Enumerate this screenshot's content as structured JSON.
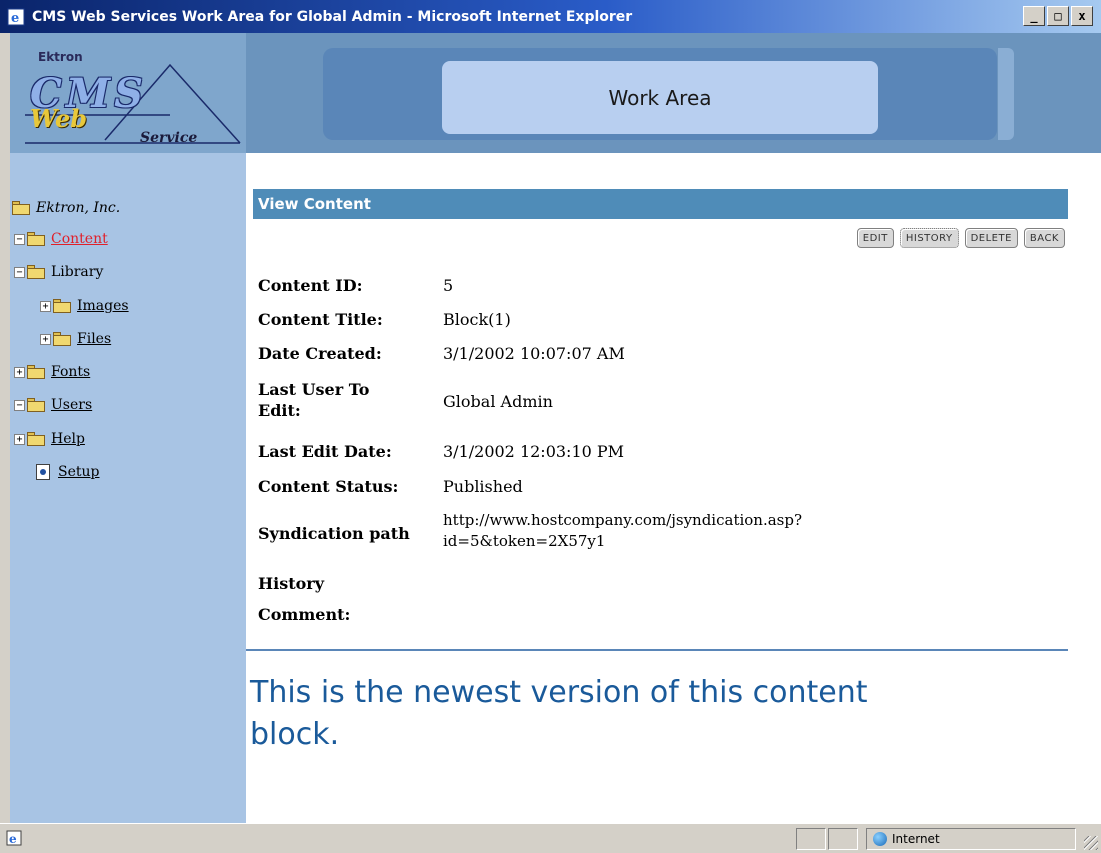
{
  "window": {
    "title": "CMS Web Services Work Area for Global Admin - Microsoft Internet Explorer",
    "minimize": "_",
    "maximize": "□",
    "close": "x"
  },
  "logo": {
    "company": "Ektron",
    "cms": "CMS",
    "web": "Web",
    "service": "Service"
  },
  "header": {
    "title": "Work Area"
  },
  "sidebar": {
    "root": "Ektron, Inc.",
    "items": [
      {
        "label": "Content",
        "icon": "folder-open-icon",
        "active": true
      },
      {
        "label": "Library",
        "icon": "folder-open-icon"
      },
      {
        "label": "Images",
        "icon": "folder-icon"
      },
      {
        "label": "Files",
        "icon": "folder-icon"
      },
      {
        "label": "Fonts",
        "icon": "folder-icon"
      },
      {
        "label": "Users",
        "icon": "folder-open-icon"
      },
      {
        "label": "Help",
        "icon": "folder-icon"
      },
      {
        "label": "Setup",
        "icon": "page-icon"
      }
    ]
  },
  "main": {
    "section_title": "View Content",
    "actions": {
      "edit": "EDIT",
      "history": "HISTORY",
      "delete": "DELETE",
      "back": "BACK"
    },
    "details": {
      "content_id_label": "Content ID:",
      "content_id": "5",
      "content_title_label": "Content Title:",
      "content_title": "Block(1)",
      "date_created_label": "Date Created:",
      "date_created": "3/1/2002 10:07:07 AM",
      "last_user_label_1": "Last User To",
      "last_user_label_2": "Edit:",
      "last_user": "Global Admin",
      "last_edit_date_label": "Last Edit Date:",
      "last_edit_date": "3/1/2002 12:03:10 PM",
      "status_label": "Content Status:",
      "status": "Published",
      "syndication_label": "Syndication path",
      "syndication_1": "http://www.hostcompany.com/jsyndication.asp?",
      "syndication_2": "id=5&token=2X57y1",
      "history_label_1": "History",
      "history_label_2": "Comment:"
    },
    "message_1": "This is the newest version of this content",
    "message_2": "block."
  },
  "statusbar": {
    "zone": "Internet"
  },
  "colors": {
    "accent": "#4f8cb8",
    "sidebar": "#a8c4e4",
    "active_link": "#e0202a",
    "message": "#1a5a9a"
  }
}
